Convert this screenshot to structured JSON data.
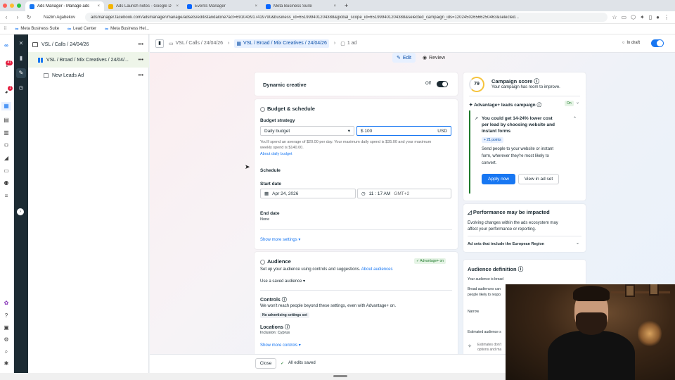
{
  "browser": {
    "tabs": [
      {
        "title": "Ads Manager - Manage ads",
        "active": true
      },
      {
        "title": "Ads Launch notes - Google D",
        "active": false
      },
      {
        "title": "Events Manager",
        "active": false
      },
      {
        "title": "Meta Business Suite",
        "active": false
      }
    ],
    "profile": "Nazim Agabekov",
    "url": "adsmanager.facebook.com/adsmanager/manage/adsets/edit/standalone?act=691043917419790&business_id=651999401204388&global_scope_id=651999401204388&selected_campaign_ids=120245026566250463&selected...",
    "bookmarks": [
      "Meta Business Suite",
      "Lead Center",
      "Meta Business Hel..."
    ]
  },
  "rail": {
    "notif_badge_1": "41",
    "notif_badge_2": "1"
  },
  "tree": {
    "items": [
      {
        "label": "VSL / Calls / 24/04/26",
        "more": "•••"
      },
      {
        "label": "VSL / Broad / Mix Creatives / 24/04/...",
        "more": "•••"
      },
      {
        "label": "New Leads Ad",
        "more": "•••"
      }
    ]
  },
  "toolbar": {
    "crumbs": [
      "VSL / Calls / 24/04/26",
      "VSL / Broad / Mix Creatives / 24/04/26",
      "1 ad"
    ],
    "status": "In draft"
  },
  "view_tabs": {
    "edit": "Edit",
    "review": "Review"
  },
  "dynamic": {
    "label": "Dynamic creative",
    "state": "Off"
  },
  "budget": {
    "title": "Budget & schedule",
    "strategy_label": "Budget strategy",
    "strategy_value": "Daily budget",
    "amount": "$ 100",
    "currency": "USD",
    "note_line1": "You'll spend an average of $20.00 per day. Your maximum daily spend is $35.00 and your maximum",
    "note_line2": "weekly spend is $140.00.",
    "about_link": "About daily budget",
    "schedule": "Schedule",
    "start_label": "Start date",
    "start_date": "Apr 24, 2026",
    "start_time": "11 : 17 AM",
    "timezone": "GMT+2",
    "end_label": "End date",
    "end_value": "None",
    "show_more": "Show more settings ▾"
  },
  "audience": {
    "title": "Audience",
    "pill": "✓ Advantage+ on",
    "desc": "Set up your audience using controls and suggestions.",
    "about_link": "About audiences",
    "saved": "Use a saved audience",
    "controls_title": "Controls",
    "controls_desc": "We won't reach people beyond these settings, even with Advantage+ on.",
    "no_adv": "No advertising settings set",
    "locations_title": "Locations",
    "locations_value": "Inclusion: Cyprus",
    "show_more": "Show more controls ▾"
  },
  "footer": {
    "close": "Close",
    "saved": "All edits saved"
  },
  "score": {
    "value": "79",
    "title": "Campaign score",
    "subtitle": "Your campaign has room to improve.",
    "advantage_label": "Advantage+ leads campaign",
    "advantage_state": "On",
    "tip_title_1": "You could get 14-24% lower cost",
    "tip_title_2": "per lead by choosing website and",
    "tip_title_3": "instant forms",
    "points": "+ 21 points",
    "tip_body_1": "Send people to your website or instant",
    "tip_body_2": "form, wherever they're most likely to",
    "tip_body_3": "convert.",
    "apply": "Apply now",
    "view": "View in ad set"
  },
  "performance": {
    "title": "Performance may be impacted",
    "body_1": "Evolving changes within the ads ecosystem may",
    "body_2": "affect your performance or reporting.",
    "eu": "Ad sets that include the European Region"
  },
  "definition": {
    "title": "Audience definition",
    "line1": "Your audience is broad",
    "line2": "Broad audiences can",
    "line3": "people likely to respo",
    "narrow": "Narrow",
    "estimated": "Estimated audience s",
    "est1": "Estimates don't",
    "est2": "options and ma"
  },
  "colors": {
    "accent": "#1877f2",
    "dark_rail": "#1c2b33",
    "selected_row": "#eef5e9"
  }
}
